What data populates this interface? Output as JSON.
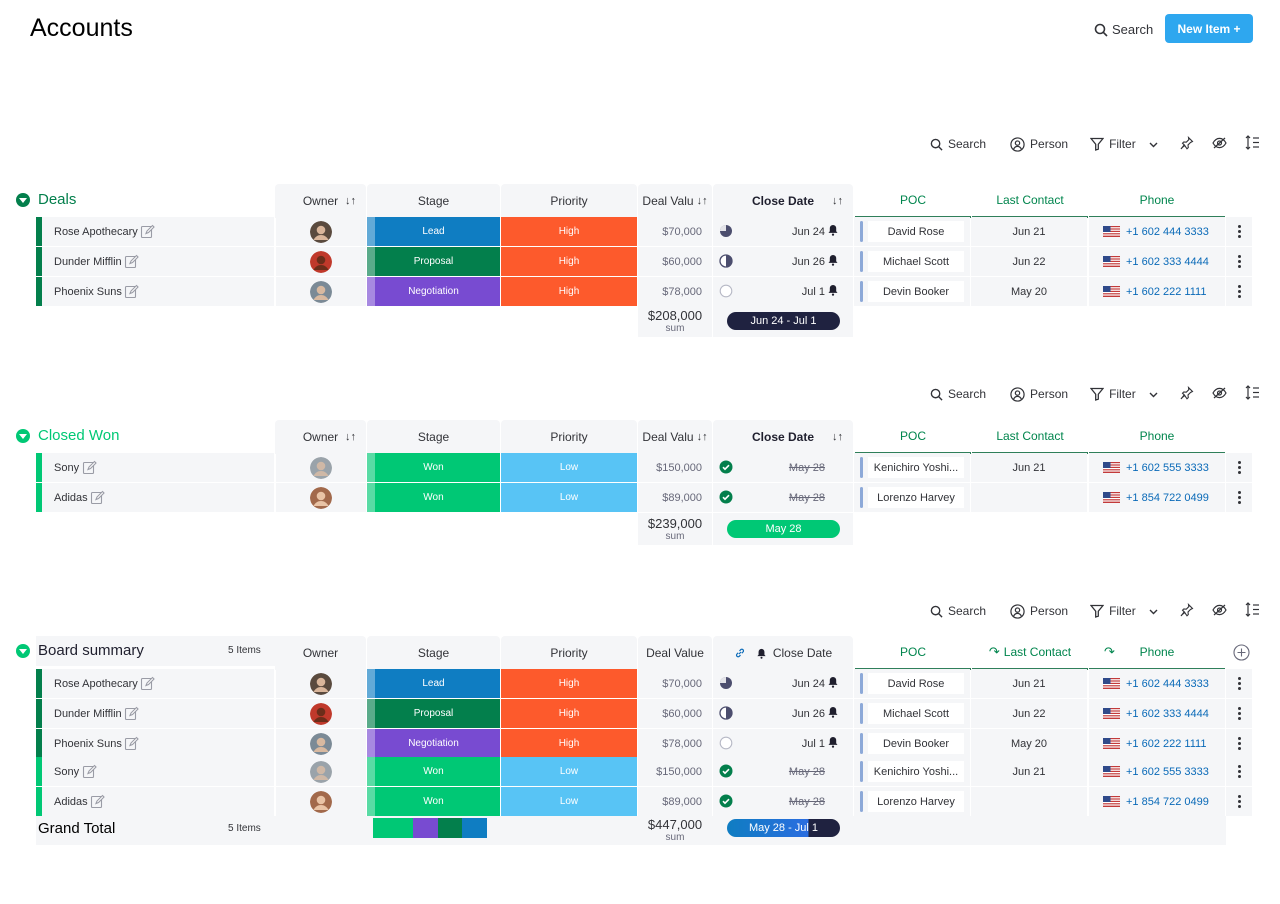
{
  "page": {
    "title": "Accounts",
    "search_label": "Search",
    "new_item_label": "New Item +"
  },
  "toolbar": {
    "search": "Search",
    "person": "Person",
    "filter": "Filter"
  },
  "columns": {
    "owner": "Owner",
    "stage": "Stage",
    "priority": "Priority",
    "deal_value_short": "Deal Valu",
    "deal_value": "Deal Value",
    "close_date": "Close Date",
    "poc": "POC",
    "last_contact": "Last Contact",
    "phone": "Phone"
  },
  "colors": {
    "group_dark": "#037f4c",
    "group_light": "#00c875",
    "lead": "#0f7dc2",
    "proposal": "#037f4c",
    "negotiation": "#784bd1",
    "won": "#00c875",
    "high": "#fd5a2c",
    "low": "#58c4f5"
  },
  "deals": {
    "title": "Deals",
    "rows": [
      {
        "name": "Rose Apothecary",
        "stage": "Lead",
        "priority": "High",
        "deal": "$70,000",
        "close": "Jun 24",
        "poc": "David Rose",
        "last": "Jun 21",
        "phone": "+1 602 444 3333"
      },
      {
        "name": "Dunder Mifflin",
        "stage": "Proposal",
        "priority": "High",
        "deal": "$60,000",
        "close": "Jun 26",
        "poc": "Michael Scott",
        "last": "Jun 22",
        "phone": "+1 602 333 4444"
      },
      {
        "name": "Phoenix Suns",
        "stage": "Negotiation",
        "priority": "High",
        "deal": "$78,000",
        "close": "Jul 1",
        "poc": "Devin Booker",
        "last": "May 20",
        "phone": "+1 602 222 1111"
      }
    ],
    "sum": "$208,000",
    "sum_label": "sum",
    "range": "Jun 24 - Jul 1"
  },
  "closed_won": {
    "title": "Closed Won",
    "rows": [
      {
        "name": "Sony",
        "stage": "Won",
        "priority": "Low",
        "deal": "$150,000",
        "close": "May 28",
        "poc": "Kenichiro Yoshi...",
        "last": "Jun 21",
        "phone": "+1 602 555 3333"
      },
      {
        "name": "Adidas",
        "stage": "Won",
        "priority": "Low",
        "deal": "$89,000",
        "close": "May 28",
        "poc": "Lorenzo Harvey",
        "last": "",
        "phone": "+1 854 722 0499"
      }
    ],
    "sum": "$239,000",
    "sum_label": "sum",
    "range": "May 28"
  },
  "summary": {
    "title": "Board summary",
    "count": "5 Items",
    "rows": [
      {
        "name": "Rose Apothecary",
        "stage": "Lead",
        "priority": "High",
        "deal": "$70,000",
        "close": "Jun 24",
        "poc": "David Rose",
        "last": "Jun 21",
        "phone": "+1 602 444 3333"
      },
      {
        "name": "Dunder Mifflin",
        "stage": "Proposal",
        "priority": "High",
        "deal": "$60,000",
        "close": "Jun 26",
        "poc": "Michael Scott",
        "last": "Jun 22",
        "phone": "+1 602 333 4444"
      },
      {
        "name": "Phoenix Suns",
        "stage": "Negotiation",
        "priority": "High",
        "deal": "$78,000",
        "close": "Jul 1",
        "poc": "Devin Booker",
        "last": "May 20",
        "phone": "+1 602 222 1111"
      },
      {
        "name": "Sony",
        "stage": "Won",
        "priority": "Low",
        "deal": "$150,000",
        "close": "May 28",
        "poc": "Kenichiro Yoshi...",
        "last": "Jun 21",
        "phone": "+1 602 555 3333"
      },
      {
        "name": "Adidas",
        "stage": "Won",
        "priority": "Low",
        "deal": "$89,000",
        "close": "May 28",
        "poc": "Lorenzo Harvey",
        "last": "",
        "phone": "+1 854 722 0499"
      }
    ],
    "grand_total": "Grand Total",
    "grand_count": "5 Items",
    "sum": "$447,000",
    "sum_label": "sum",
    "range": "May 28 - Jul 1"
  }
}
